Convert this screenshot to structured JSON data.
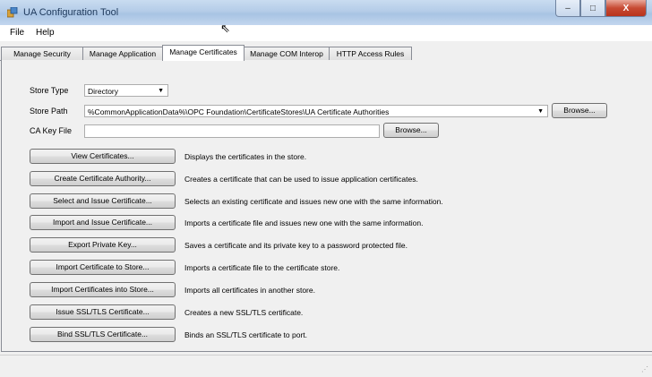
{
  "window": {
    "title": "UA Configuration Tool",
    "minimize": "–",
    "maximize": "□",
    "close": "X"
  },
  "menu": [
    "File",
    "Help"
  ],
  "tabs": [
    "Manage Security",
    "Manage Application",
    "Manage Certificates",
    "Manage COM Interop",
    "HTTP Access Rules"
  ],
  "active_tab": "Manage Certificates",
  "form": {
    "store_type_label": "Store Type",
    "store_type_value": "Directory",
    "store_path_label": "Store Path",
    "store_path_value": "%CommonApplicationData%\\OPC Foundation\\CertificateStores\\UA Certificate Authorities",
    "ca_key_file_label": "CA Key File",
    "ca_key_file_value": "",
    "browse_label": "Browse..."
  },
  "actions": [
    {
      "button": "View Certificates...",
      "description": "Displays the certificates in the store."
    },
    {
      "button": "Create Certificate Authority...",
      "description": "Creates a certificate that can be used to issue application certificates."
    },
    {
      "button": "Select and Issue Certificate...",
      "description": "Selects an existing certificate and issues new one with the same information."
    },
    {
      "button": "Import and Issue Certificate...",
      "description": "Imports a certificate file and issues new one with the same information."
    },
    {
      "button": "Export Private Key...",
      "description": "Saves a certificate and its private key to a password protected file."
    },
    {
      "button": "Import Certificate to Store...",
      "description": "Imports a certificate file to the certificate store."
    },
    {
      "button": "Import Certificates into Store...",
      "description": "Imports all certificates in another store."
    },
    {
      "button": "Issue SSL/TLS Certificate...",
      "description": "Creates a new SSL/TLS certificate."
    },
    {
      "button": "Bind SSL/TLS Certificate...",
      "description": "Binds an SSL/TLS certificate to port."
    }
  ]
}
